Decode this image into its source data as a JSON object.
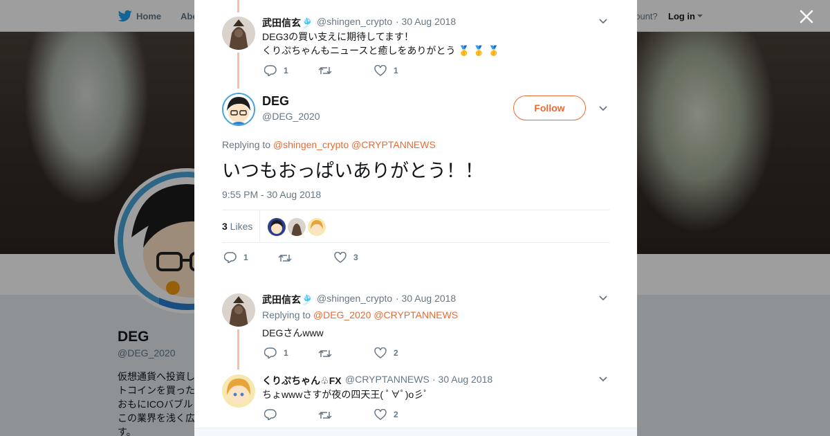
{
  "nav": {
    "home_label": "Home",
    "about_label": "Abo",
    "account_prompt": "account?",
    "login_label": "Log in"
  },
  "profile": {
    "name": "DEG",
    "handle": "@DEG_2020",
    "bio_lines": [
      "仮想通貨へ投資し",
      "トコインを買った",
      "おもにICOバブル",
      "この業界を浅く広",
      "す。"
    ]
  },
  "colors": {
    "accent": "#e86a33",
    "thread_line": "#f4c0a6",
    "text": "#14171a",
    "muted": "#657786"
  },
  "tweets": [
    {
      "name": "武田信玄",
      "name_emoji": "🎐",
      "handle": "@shingen_crypto",
      "date": "· 30 Aug 2018",
      "lines": [
        "DEG3の買い支えに期待してます！",
        "くりぷちゃんもニュースと癒しをありがとう"
      ],
      "medals": "🥇 🥇 🥇",
      "reply_count": "1",
      "retweet_count": "",
      "like_count": "1"
    }
  ],
  "main_tweet": {
    "name": "DEG",
    "handle": "@DEG_2020",
    "follow_label": "Follow",
    "replying_prefix": "Replying to ",
    "replying_to": [
      "@shingen_crypto",
      "@CRYPTANNEWS"
    ],
    "text": "いつもおっぱいありがとう！！",
    "timestamp": "9:55 PM - 30 Aug 2018",
    "likes_number": "3",
    "likes_label": " Likes",
    "reply_count": "1",
    "retweet_count": "",
    "like_count": "3"
  },
  "replies": [
    {
      "name": "武田信玄",
      "name_emoji": "🎐",
      "handle": "@shingen_crypto",
      "date": "· 30 Aug 2018",
      "replying_prefix": "Replying to ",
      "replying_to": [
        "@DEG_2020",
        "@CRYPTANNEWS"
      ],
      "text": "DEGさんwww",
      "reply_count": "1",
      "retweet_count": "",
      "like_count": "2"
    },
    {
      "name": "くりぷちゃん♧FX",
      "handle": "@CRYPTANNEWS",
      "date": "· 30 Aug 2018",
      "text": "ちょwwwさすが夜の四天王( ﾟ∀ﾟ)o彡ﾟ",
      "reply_count": "",
      "retweet_count": "",
      "like_count": "2"
    }
  ],
  "icons": [
    "twitter-bird-icon",
    "close-icon",
    "chevron-down-icon",
    "reply-icon",
    "retweet-icon",
    "heart-icon"
  ]
}
